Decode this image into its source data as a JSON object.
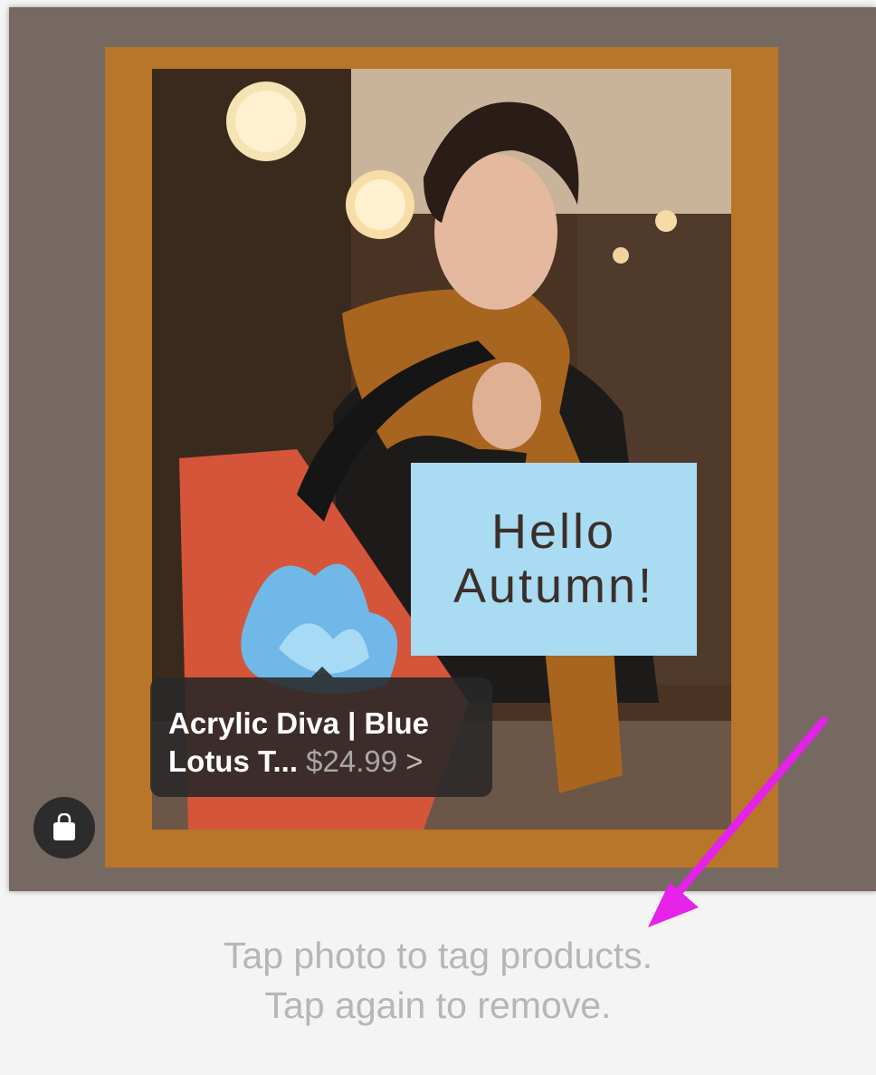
{
  "overlay_text": {
    "line1": "Hello",
    "line2": "Autumn!"
  },
  "product_tag": {
    "line1": "Acrylic Diva | Blue",
    "line2_title": "Lotus T...",
    "price": "$24.99",
    "chevron": ">"
  },
  "hint": {
    "line1": "Tap photo to tag products.",
    "line2": "Tap again to remove."
  },
  "icons": {
    "shop": "shopping-bag-icon",
    "arrow": "annotation-arrow-icon"
  },
  "colors": {
    "background": "#766961",
    "frame": "#b8762a",
    "text_box": "#a9dbf3",
    "arrow": "#e522e8"
  }
}
